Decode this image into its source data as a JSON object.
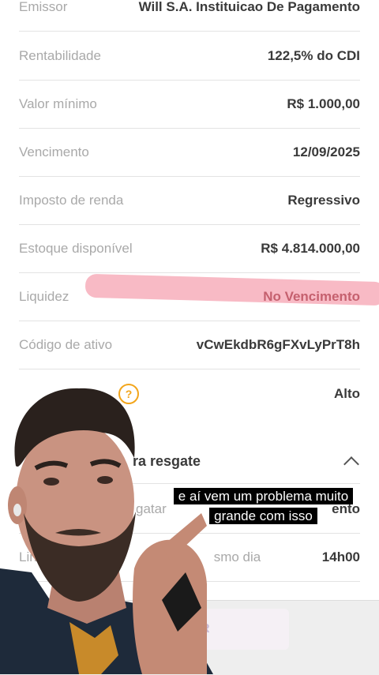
{
  "details": [
    {
      "label": "Emissor",
      "value": "Will S.A. Instituicao De Pagamento"
    },
    {
      "label": "Rentabilidade",
      "value": "122,5% do CDI"
    },
    {
      "label": "Valor mínimo",
      "value": "R$ 1.000,00"
    },
    {
      "label": "Vencimento",
      "value": "12/09/2025"
    },
    {
      "label": "Imposto de renda",
      "value": "Regressivo"
    },
    {
      "label": "Estoque disponível",
      "value": "R$ 4.814.000,00"
    },
    {
      "label": "Liquidez",
      "value": "No Vencimento"
    },
    {
      "label": "Código de ativo",
      "value": "vCwEkdbR6gFXvLyPrT8h"
    },
    {
      "label": "",
      "value": "Alto",
      "icon": "question-circle-icon"
    }
  ],
  "redemption_section": {
    "title_fragment": "ra resgate",
    "chevron": "chevron-up-icon",
    "rows": [
      {
        "label_fragment": "gatar",
        "value_fragment": "ento"
      },
      {
        "label_fragment": "Lin",
        "label_fragment_2": "smo dia",
        "value": "14h00"
      }
    ]
  },
  "bottom_bar": {
    "button_fragment": "R"
  },
  "video_caption": "e aí vem um problema muito grande com isso",
  "colors": {
    "highlight": "#f5a3b1",
    "accent_icon": "#f2a51b"
  }
}
